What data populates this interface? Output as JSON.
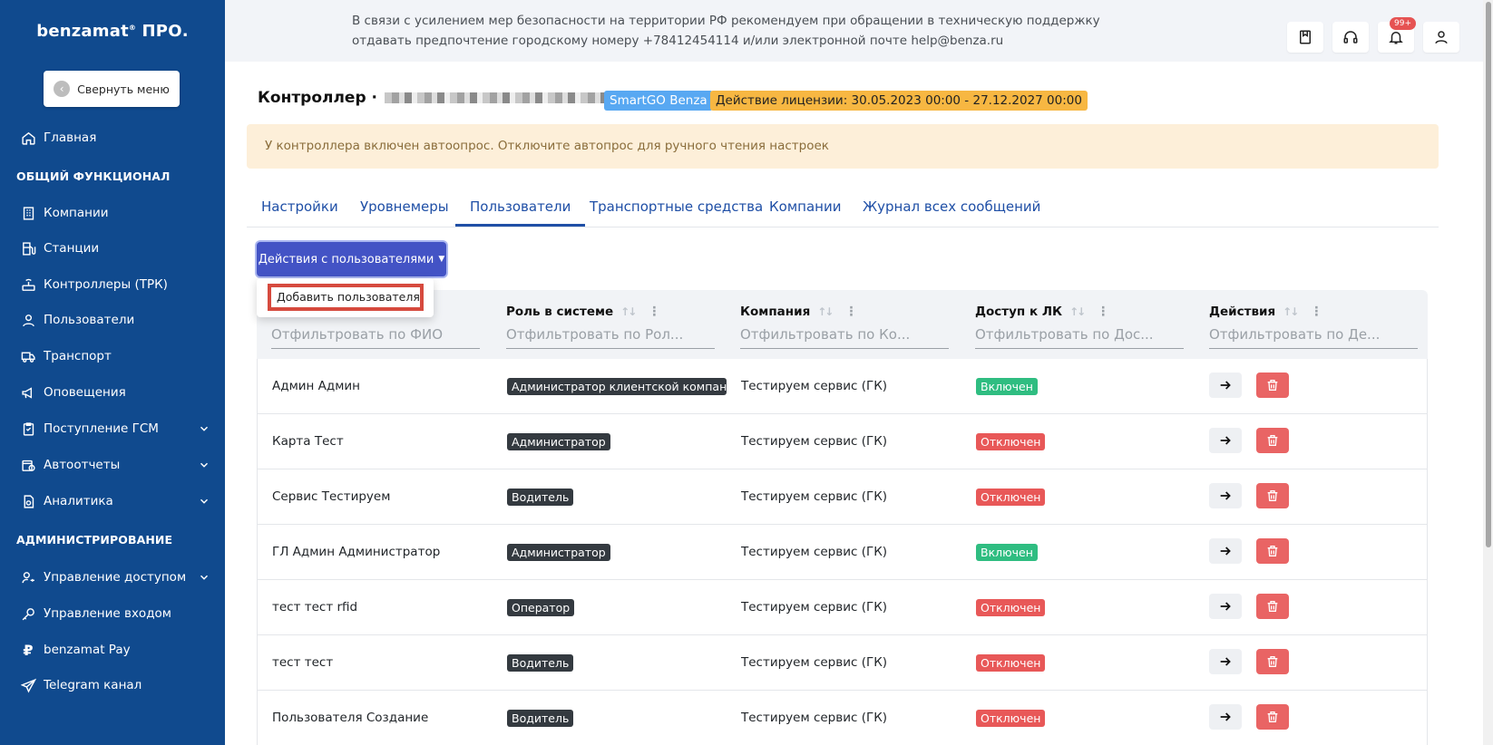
{
  "sidebar": {
    "brand": "benzamat",
    "brand_mark": "®",
    "brand_suffix": "ПРО.",
    "collapse_label": "Свернуть меню",
    "items": [
      {
        "label": "Главная",
        "icon": "home-icon"
      },
      {
        "label": "Компании",
        "icon": "building-icon"
      },
      {
        "label": "Станции",
        "icon": "fuel-station-icon"
      },
      {
        "label": "Контроллеры (ТРК)",
        "icon": "router-icon"
      },
      {
        "label": "Пользователи",
        "icon": "user-icon"
      },
      {
        "label": "Транспорт",
        "icon": "truck-icon"
      },
      {
        "label": "Оповещения",
        "icon": "megaphone-icon"
      },
      {
        "label": "Поступление ГСМ",
        "icon": "clipboard-icon"
      },
      {
        "label": "Автоотчеты",
        "icon": "calendar-clock-icon"
      },
      {
        "label": "Аналитика",
        "icon": "chart-file-icon"
      },
      {
        "label": "Управление доступом",
        "icon": "user-key-icon"
      },
      {
        "label": "Управление входом",
        "icon": "key-icon"
      },
      {
        "label": "benzamat Pay",
        "icon": "ruble-icon"
      },
      {
        "label": "Telegram канал",
        "icon": "send-icon"
      }
    ],
    "sections": {
      "general": "ОБЩИЙ ФУНКЦИОНАЛ",
      "admin": "АДМИНИСТРИРОВАНИЕ"
    }
  },
  "topbar": {
    "notice": "В связи с усилением мер безопасности на территории РФ рекомендуем при обращении в техническую поддержку отдавать предпочтение городскому номеру +78412454114 и/или электронной почте help@benza.ru",
    "notification_count": "99+",
    "icons": [
      "book-icon",
      "headset-icon",
      "bell-icon",
      "user-icon"
    ]
  },
  "header": {
    "title": "Контроллер ·",
    "platform_tag": "SmartGO Benza",
    "license_tag": "Действие лицензии: 30.05.2023 00:00 - 27.12.2027 00:00"
  },
  "alert": {
    "text": "У контроллера включен автоопрос. Отключите автопрос для ручного чтения настроек"
  },
  "tabs": [
    {
      "label": "Настройки",
      "active": false
    },
    {
      "label": "Уровнемеры",
      "active": false
    },
    {
      "label": "Пользователи",
      "active": true
    },
    {
      "label": "Транспортные средства",
      "active": false
    },
    {
      "label": "Компании",
      "active": false
    },
    {
      "label": "Журнал всех сообщений",
      "active": false
    }
  ],
  "actions": {
    "button_label": "Действия с пользователями",
    "dropdown_items": [
      "Добавить пользователя"
    ]
  },
  "table": {
    "columns": [
      {
        "label": "",
        "filter_placeholder": "Отфильтровать по ФИО"
      },
      {
        "label": "Роль в системе",
        "filter_placeholder": "Отфильтровать по Рол..."
      },
      {
        "label": "Компания",
        "filter_placeholder": "Отфильтровать по Ко..."
      },
      {
        "label": "Доступ к ЛК",
        "filter_placeholder": "Отфильтровать по Дос..."
      },
      {
        "label": "Действия",
        "filter_placeholder": "Отфильтровать по Де..."
      }
    ],
    "rows": [
      {
        "name": "Админ Админ",
        "role": "Администратор клиентской компании",
        "company": "Тестируем сервис (ГК)",
        "access": "Включен",
        "access_on": true
      },
      {
        "name": "Карта Тест",
        "role": "Администратор",
        "company": "Тестируем сервис (ГК)",
        "access": "Отключен",
        "access_on": false
      },
      {
        "name": "Сервис Тестируем",
        "role": "Водитель",
        "company": "Тестируем сервис (ГК)",
        "access": "Отключен",
        "access_on": false
      },
      {
        "name": "ГЛ Админ Администратор",
        "role": "Администратор",
        "company": "Тестируем сервис (ГК)",
        "access": "Включен",
        "access_on": true
      },
      {
        "name": "тест тест rfid",
        "role": "Оператор",
        "company": "Тестируем сервис (ГК)",
        "access": "Отключен",
        "access_on": false
      },
      {
        "name": "тест тест",
        "role": "Водитель",
        "company": "Тестируем сервис (ГК)",
        "access": "Отключен",
        "access_on": false
      },
      {
        "name": "Пользователя Создание",
        "role": "Водитель",
        "company": "Тестируем сервис (ГК)",
        "access": "Отключен",
        "access_on": false
      }
    ]
  },
  "colors": {
    "sidebar_bg": "#104a8e",
    "primary": "#4353c5",
    "link": "#1f4fa6",
    "success": "#2fbd81",
    "danger": "#e85858",
    "warning_bg": "#fdefd9",
    "license_tag": "#f7b742",
    "platform_tag": "#58a8f2"
  }
}
